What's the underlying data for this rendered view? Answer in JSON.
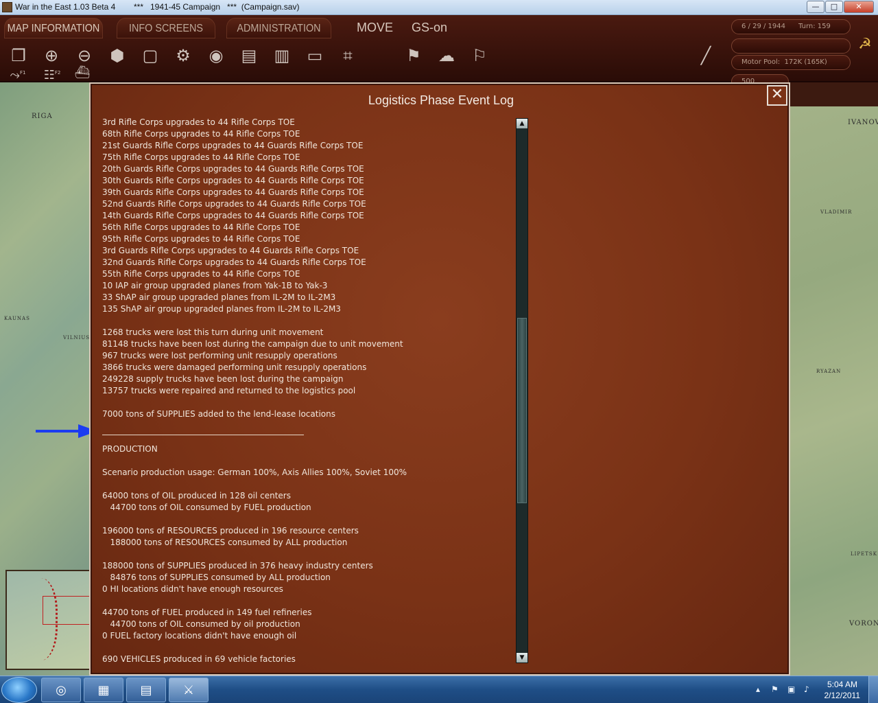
{
  "window": {
    "title": "War in the East 1.03 Beta 4        ***   1941-45 Campaign   ***  (Campaign.sav)",
    "min_label": "—",
    "max_label": "□",
    "close_label": "✕"
  },
  "gamebar": {
    "tabs": [
      "MAP INFORMATION",
      "INFO SCREENS",
      "ADMINISTRATION"
    ],
    "mode_label": "MOVE",
    "gs_label": "GS-on",
    "date_turn": "6 / 29 / 1944      Turn: 159",
    "motor_pool": "Motor Pool:  172K (165K)",
    "counter_value": "500",
    "row2": {
      "f1": "F1",
      "f2": "F2"
    }
  },
  "map": {
    "cities_left": [
      "RIGA",
      "KAUNAS",
      "VILNIUS"
    ],
    "cities_right": [
      "IVANOVO",
      "VLADIMIR",
      "RYAZAN",
      "LIPETSK",
      "VORONEZH"
    ]
  },
  "dialog": {
    "title": "Logistics Phase Event Log",
    "close_label": "✕",
    "lines": [
      "3rd Rifle Corps upgrades to 44 Rifle Corps TOE",
      "68th Rifle Corps upgrades to 44 Rifle Corps TOE",
      "21st Guards Rifle Corps upgrades to 44 Guards Rifle Corps TOE",
      "75th Rifle Corps upgrades to 44 Rifle Corps TOE",
      "20th Guards Rifle Corps upgrades to 44 Guards Rifle Corps TOE",
      "30th Guards Rifle Corps upgrades to 44 Guards Rifle Corps TOE",
      "39th Guards Rifle Corps upgrades to 44 Guards Rifle Corps TOE",
      "52nd Guards Rifle Corps upgrades to 44 Guards Rifle Corps TOE",
      "14th Guards Rifle Corps upgrades to 44 Guards Rifle Corps TOE",
      "56th Rifle Corps upgrades to 44 Rifle Corps TOE",
      "95th Rifle Corps upgrades to 44 Rifle Corps TOE",
      "3rd Guards Rifle Corps upgrades to 44 Guards Rifle Corps TOE",
      "32nd Guards Rifle Corps upgrades to 44 Guards Rifle Corps TOE",
      "55th Rifle Corps upgrades to 44 Rifle Corps TOE",
      "10 IAP air group upgraded planes from Yak-1B to Yak-3",
      "33 ShAP air group upgraded planes from IL-2M to IL-2M3",
      "135 ShAP air group upgraded planes from IL-2M to IL-2M3",
      "",
      "1268 trucks were lost this turn during unit movement",
      "81148 trucks have been lost during the campaign due to unit movement",
      "967 trucks were lost performing unit resupply operations",
      "3866 trucks were damaged performing unit resupply operations",
      "249228 supply trucks have been lost during the campaign",
      "13757 trucks were repaired and returned to the logistics pool",
      "",
      "7000 tons of SUPPLIES added to the lend-lease locations",
      "__SEPARATOR__",
      "PRODUCTION",
      "",
      "Scenario production usage: German 100%, Axis Allies 100%, Soviet 100%",
      "",
      "64000 tons of OIL produced in 128 oil centers",
      "   44700 tons of OIL consumed by FUEL production",
      "",
      "196000 tons of RESOURCES produced in 196 resource centers",
      "   188000 tons of RESOURCES consumed by ALL production",
      "",
      "188000 tons of SUPPLIES produced in 376 heavy industry centers",
      "   84876 tons of SUPPLIES consumed by ALL production",
      "0 HI locations didn't have enough resources",
      "",
      "44700 tons of FUEL produced in 149 fuel refineries",
      "   44700 tons of OIL consumed by oil production",
      "0 FUEL factory locations didn't have enough oil",
      "",
      "690 VEHICLES produced in 69 vehicle factories"
    ]
  },
  "taskbar": {
    "clock_time": "5:04 AM",
    "clock_date": "2/12/2011"
  }
}
